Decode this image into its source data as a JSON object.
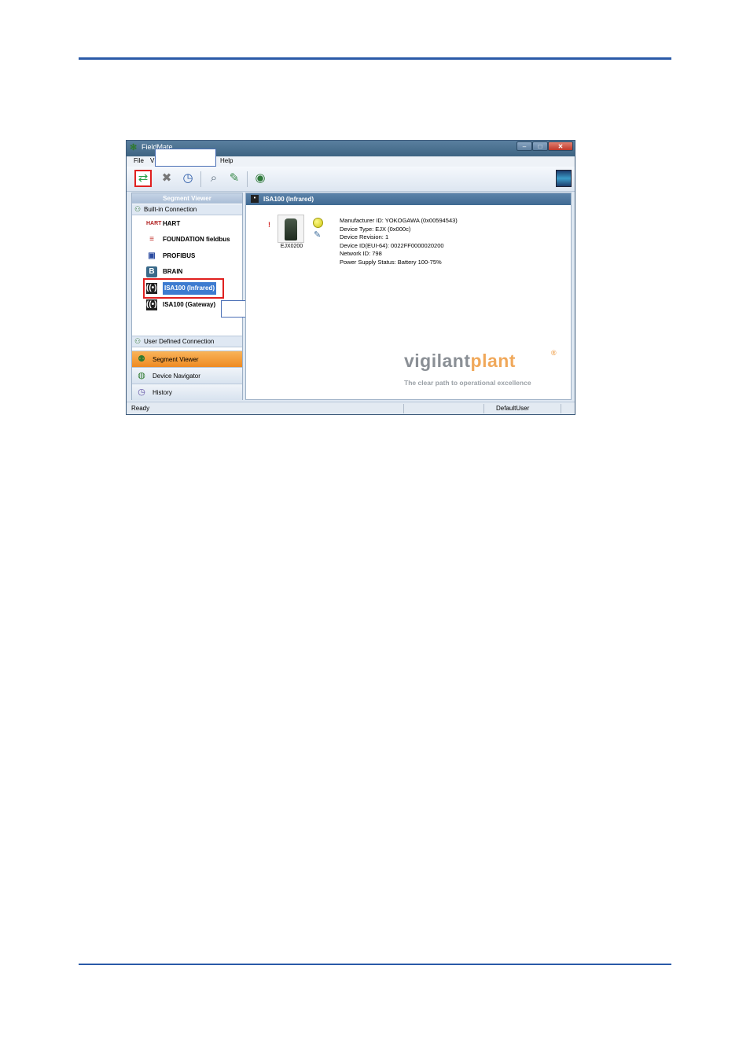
{
  "window": {
    "title": "FieldMate",
    "controls": {
      "minimize": "–",
      "maximize": "□",
      "close": "✕"
    }
  },
  "menu": {
    "file": "File",
    "view": "V",
    "help": "Help"
  },
  "toolbar": {
    "icons": [
      "connect-icon",
      "disconnect-icon",
      "schedule-icon",
      "search-icon",
      "tools-icon",
      "network-icon"
    ]
  },
  "segment_viewer": {
    "header": "Segment Viewer",
    "builtin_group": "Built-in Connection",
    "items": [
      {
        "label": "HART",
        "icon_text": "HART"
      },
      {
        "label": "FOUNDATION fieldbus"
      },
      {
        "label": "PROFIBUS"
      },
      {
        "label": "BRAIN",
        "icon_text": "B"
      },
      {
        "label": "ISA100 (Infrared)",
        "selected": true
      },
      {
        "label": "ISA100 (Gateway)"
      }
    ],
    "user_group": "User Defined Connection"
  },
  "nav": [
    {
      "label": "Segment Viewer",
      "active": true
    },
    {
      "label": "Device Navigator"
    },
    {
      "label": "History"
    }
  ],
  "content": {
    "header": "ISA100 (Infrared)",
    "alarm_mark": "!",
    "device_name": "EJX0200",
    "info": [
      "Manufacturer ID: YOKOGAWA (0x00594543)",
      "Device Type: EJX (0x000c)",
      "Device Revision: 1",
      "Device ID(EUI-64): 0022FF0000020200",
      "Network ID: 798",
      "Power Supply Status: Battery 100-75%"
    ],
    "logo_part1": "vigilant",
    "logo_part2": "plant",
    "logo_reg": "®",
    "tagline": "The clear path to operational excellence"
  },
  "statusbar": {
    "status": "Ready",
    "user": "DefaultUser"
  },
  "colors": {
    "rule": "#2a5aa8",
    "highlight": "#e0201f",
    "selection": "#3d7bd0",
    "nav_active": "#ee8a22"
  }
}
